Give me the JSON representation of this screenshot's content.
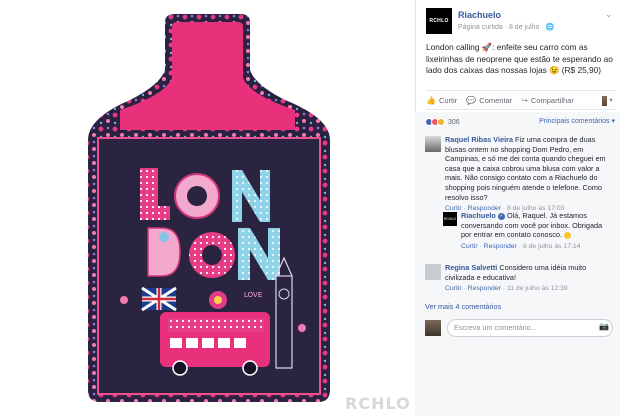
{
  "photo": {
    "watermark": "RCHLO",
    "letters": [
      "L",
      "O",
      "N",
      "D",
      "O",
      "N"
    ],
    "bag_label": "LOVE"
  },
  "post": {
    "page_logo": "RCHLO",
    "page_name": "Riachuelo",
    "meta": "Página curtida · 8 de julho · ",
    "text": "London calling 🚀: enfeite seu carro com as lixeirinhas de neoprene que estão te esperando ao lado dos caixas das nossas lojas 😉 (R$ 25,90)"
  },
  "actions": {
    "like": "Curtir",
    "comment": "Comentar",
    "share": "Compartilhar"
  },
  "reactions": {
    "count": "306",
    "sort": "Principais comentários ▾"
  },
  "comments": [
    {
      "author": "Raquel Ribas Vieira",
      "text": "Fiz uma compra de duas blusas ontem no shopping Dom Pedro, em Campinas, e só me dei conta quando cheguei em casa que a caixa cobrou uma blusa com valor a mais. Não consigo contato com a Riachuelo do shopping pois ninguém atende o telefone. Como resolvo isso?",
      "like": "Curtir",
      "reply": "Responder",
      "date": "8 de julho às 17:03"
    },
    {
      "author": "Riachuelo",
      "text": "Olá, Raquel. Já estamos conversando com você por inbox. Obrigada por entrar em contato conosco.",
      "like": "Curtir",
      "reply": "Responder",
      "date": "8 de julho às 17:14"
    },
    {
      "author": "Regina Salvetti",
      "text": "Considero uma idéia muito civilizada e educativa!",
      "like": "Curtir",
      "reply": "Responder",
      "date": "11 de julho às 12:39"
    }
  ],
  "more_comments": "Ver mais 4 comentários",
  "compose": {
    "placeholder": "Escreva um comentário..."
  },
  "colors": {
    "link": "#365899",
    "action": "#4267b2",
    "bag_pink": "#e8317a",
    "bag_navy": "#2b2440"
  }
}
